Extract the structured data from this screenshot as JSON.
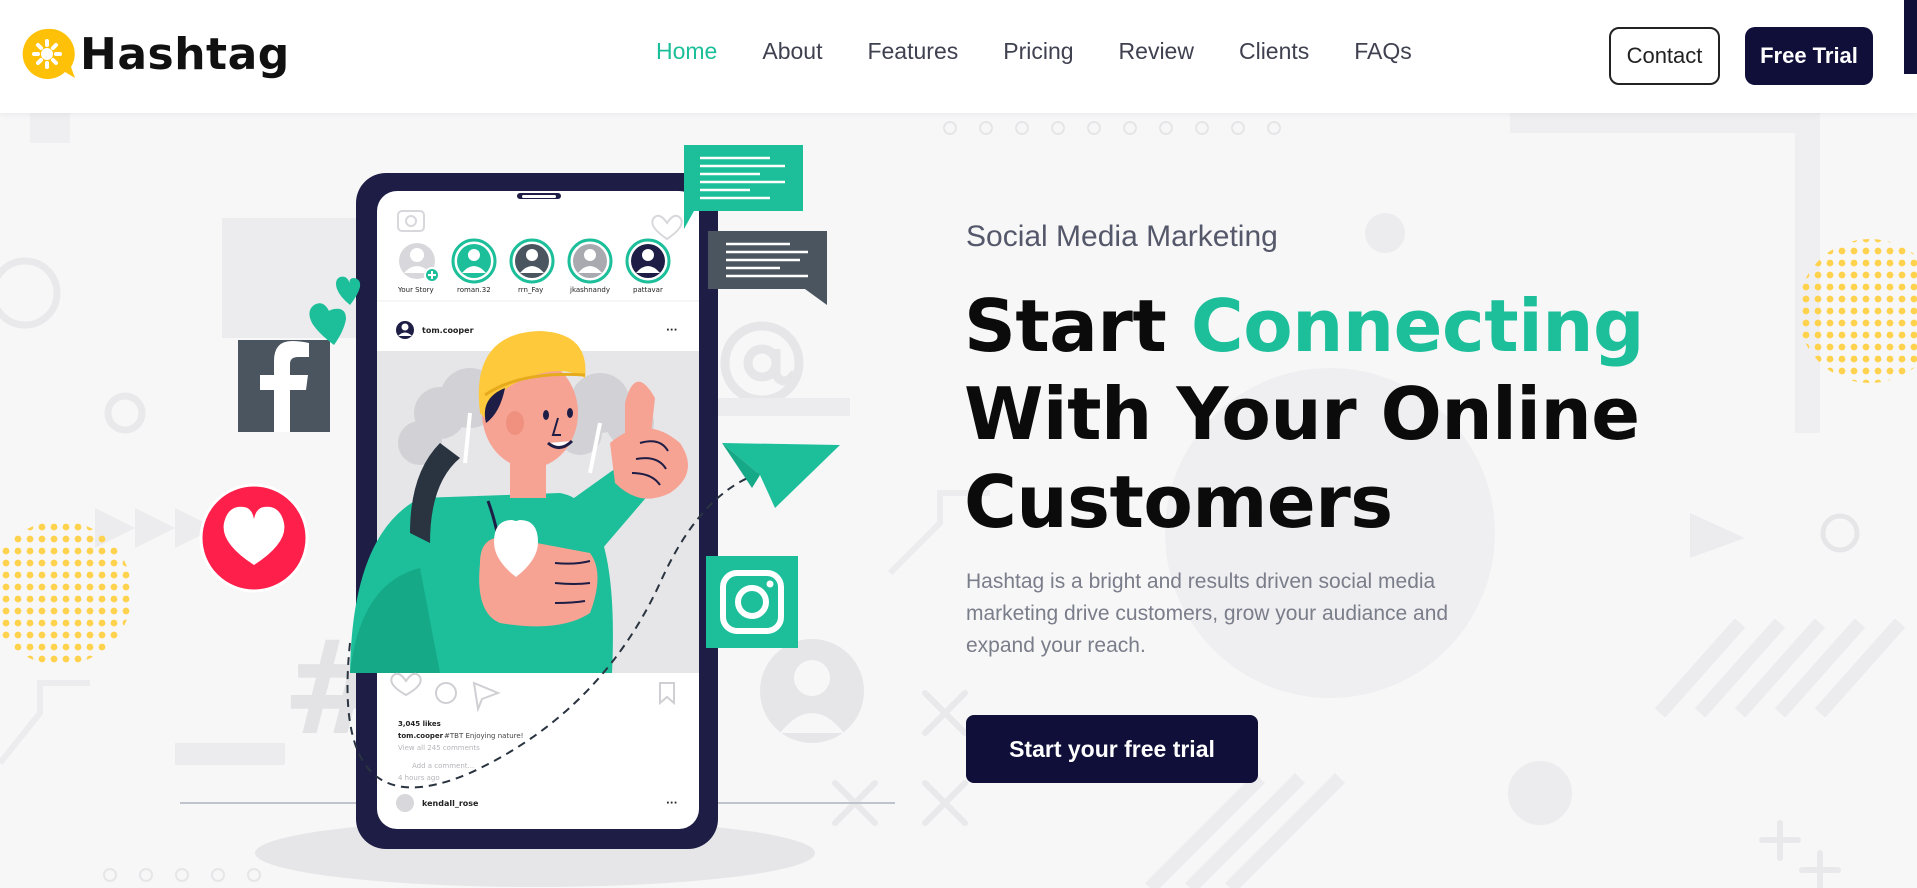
{
  "brand": {
    "name": "Hashtag"
  },
  "nav": {
    "items": [
      {
        "label": "Home",
        "active": true
      },
      {
        "label": "About"
      },
      {
        "label": "Features"
      },
      {
        "label": "Pricing"
      },
      {
        "label": "Review"
      },
      {
        "label": "Clients"
      },
      {
        "label": "FAQs"
      }
    ]
  },
  "header": {
    "contact_label": "Contact",
    "trial_label": "Free Trial"
  },
  "hero": {
    "subtitle": "Social Media Marketing",
    "headline_start": "Start ",
    "headline_accent": "Connecting",
    "headline_line2": "With Your Online",
    "headline_line3": "Customers",
    "description": "Hashtag is a bright and results driven social media marketing drive customers, grow your audiance and expand your reach.",
    "cta_label": "Start your free trial"
  },
  "phone": {
    "stories": [
      "Your Story",
      "roman.32",
      "rrn_Fay",
      "jkashnandy",
      "pattavar"
    ],
    "post_user": "tom.cooper",
    "likes": "3,045 likes",
    "caption_user": "tom.cooper",
    "caption_text": "#TBT  Enjoying nature!",
    "view_comments": "View all 245 comments",
    "add_comment": "Add a comment...",
    "time_ago": "4 hours ago",
    "next_user": "kendall_rose"
  },
  "colors": {
    "accent": "#1cbf9a",
    "dark": "#0f0f3a",
    "logo_yellow": "#ffc107",
    "heart_red": "#ff1f4b",
    "social_gray": "#4a5560"
  },
  "icons": [
    "logo-bubble-icon",
    "facebook-icon",
    "heart-icon",
    "instagram-icon",
    "paper-plane-icon",
    "chat-bubble-icon",
    "at-sign-icon"
  ]
}
